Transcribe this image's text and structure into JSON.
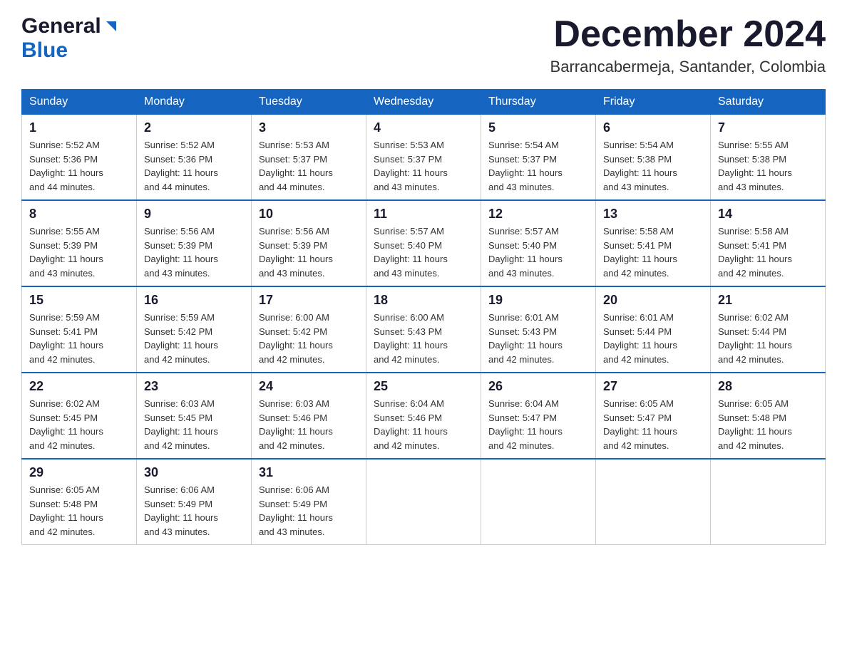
{
  "header": {
    "month_title": "December 2024",
    "location": "Barrancabermeja, Santander, Colombia"
  },
  "days_of_week": [
    "Sunday",
    "Monday",
    "Tuesday",
    "Wednesday",
    "Thursday",
    "Friday",
    "Saturday"
  ],
  "weeks": [
    [
      {
        "day": "1",
        "sunrise": "5:52 AM",
        "sunset": "5:36 PM",
        "daylight": "11 hours and 44 minutes."
      },
      {
        "day": "2",
        "sunrise": "5:52 AM",
        "sunset": "5:36 PM",
        "daylight": "11 hours and 44 minutes."
      },
      {
        "day": "3",
        "sunrise": "5:53 AM",
        "sunset": "5:37 PM",
        "daylight": "11 hours and 44 minutes."
      },
      {
        "day": "4",
        "sunrise": "5:53 AM",
        "sunset": "5:37 PM",
        "daylight": "11 hours and 43 minutes."
      },
      {
        "day": "5",
        "sunrise": "5:54 AM",
        "sunset": "5:37 PM",
        "daylight": "11 hours and 43 minutes."
      },
      {
        "day": "6",
        "sunrise": "5:54 AM",
        "sunset": "5:38 PM",
        "daylight": "11 hours and 43 minutes."
      },
      {
        "day": "7",
        "sunrise": "5:55 AM",
        "sunset": "5:38 PM",
        "daylight": "11 hours and 43 minutes."
      }
    ],
    [
      {
        "day": "8",
        "sunrise": "5:55 AM",
        "sunset": "5:39 PM",
        "daylight": "11 hours and 43 minutes."
      },
      {
        "day": "9",
        "sunrise": "5:56 AM",
        "sunset": "5:39 PM",
        "daylight": "11 hours and 43 minutes."
      },
      {
        "day": "10",
        "sunrise": "5:56 AM",
        "sunset": "5:39 PM",
        "daylight": "11 hours and 43 minutes."
      },
      {
        "day": "11",
        "sunrise": "5:57 AM",
        "sunset": "5:40 PM",
        "daylight": "11 hours and 43 minutes."
      },
      {
        "day": "12",
        "sunrise": "5:57 AM",
        "sunset": "5:40 PM",
        "daylight": "11 hours and 43 minutes."
      },
      {
        "day": "13",
        "sunrise": "5:58 AM",
        "sunset": "5:41 PM",
        "daylight": "11 hours and 42 minutes."
      },
      {
        "day": "14",
        "sunrise": "5:58 AM",
        "sunset": "5:41 PM",
        "daylight": "11 hours and 42 minutes."
      }
    ],
    [
      {
        "day": "15",
        "sunrise": "5:59 AM",
        "sunset": "5:41 PM",
        "daylight": "11 hours and 42 minutes."
      },
      {
        "day": "16",
        "sunrise": "5:59 AM",
        "sunset": "5:42 PM",
        "daylight": "11 hours and 42 minutes."
      },
      {
        "day": "17",
        "sunrise": "6:00 AM",
        "sunset": "5:42 PM",
        "daylight": "11 hours and 42 minutes."
      },
      {
        "day": "18",
        "sunrise": "6:00 AM",
        "sunset": "5:43 PM",
        "daylight": "11 hours and 42 minutes."
      },
      {
        "day": "19",
        "sunrise": "6:01 AM",
        "sunset": "5:43 PM",
        "daylight": "11 hours and 42 minutes."
      },
      {
        "day": "20",
        "sunrise": "6:01 AM",
        "sunset": "5:44 PM",
        "daylight": "11 hours and 42 minutes."
      },
      {
        "day": "21",
        "sunrise": "6:02 AM",
        "sunset": "5:44 PM",
        "daylight": "11 hours and 42 minutes."
      }
    ],
    [
      {
        "day": "22",
        "sunrise": "6:02 AM",
        "sunset": "5:45 PM",
        "daylight": "11 hours and 42 minutes."
      },
      {
        "day": "23",
        "sunrise": "6:03 AM",
        "sunset": "5:45 PM",
        "daylight": "11 hours and 42 minutes."
      },
      {
        "day": "24",
        "sunrise": "6:03 AM",
        "sunset": "5:46 PM",
        "daylight": "11 hours and 42 minutes."
      },
      {
        "day": "25",
        "sunrise": "6:04 AM",
        "sunset": "5:46 PM",
        "daylight": "11 hours and 42 minutes."
      },
      {
        "day": "26",
        "sunrise": "6:04 AM",
        "sunset": "5:47 PM",
        "daylight": "11 hours and 42 minutes."
      },
      {
        "day": "27",
        "sunrise": "6:05 AM",
        "sunset": "5:47 PM",
        "daylight": "11 hours and 42 minutes."
      },
      {
        "day": "28",
        "sunrise": "6:05 AM",
        "sunset": "5:48 PM",
        "daylight": "11 hours and 42 minutes."
      }
    ],
    [
      {
        "day": "29",
        "sunrise": "6:05 AM",
        "sunset": "5:48 PM",
        "daylight": "11 hours and 42 minutes."
      },
      {
        "day": "30",
        "sunrise": "6:06 AM",
        "sunset": "5:49 PM",
        "daylight": "11 hours and 43 minutes."
      },
      {
        "day": "31",
        "sunrise": "6:06 AM",
        "sunset": "5:49 PM",
        "daylight": "11 hours and 43 minutes."
      },
      null,
      null,
      null,
      null
    ]
  ],
  "labels": {
    "sunrise": "Sunrise:",
    "sunset": "Sunset:",
    "daylight": "Daylight:"
  }
}
